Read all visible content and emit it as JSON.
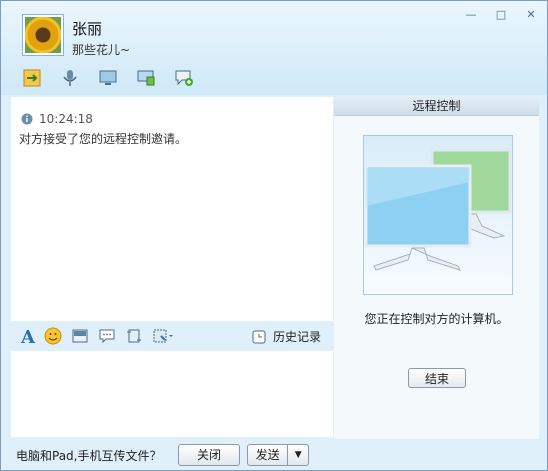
{
  "contact": {
    "name": "张丽",
    "signature": "那些花儿~"
  },
  "window_controls": {
    "minimize": "—",
    "maximize": "□",
    "close": "✕"
  },
  "toolbar": {
    "items": [
      "send-file-icon",
      "voice-icon",
      "remote-desktop-icon",
      "screen-share-icon",
      "chat-add-icon"
    ]
  },
  "chat": {
    "timestamp": "10:24:18",
    "message": "对方接受了您的远程控制邀请。"
  },
  "input_toolbar": {
    "tools": [
      "font-icon",
      "emoji-icon",
      "image-icon",
      "message-icon",
      "screenshot-icon",
      "more-icon"
    ],
    "history_label": "历史记录"
  },
  "remote_panel": {
    "title": "远程控制",
    "status": "您正在控制对方的计算机。",
    "end_button": "结束"
  },
  "bottom_bar": {
    "promo": "电脑和Pad,手机互传文件？",
    "close_button": "关闭",
    "send_button": "发送"
  },
  "colors": {
    "accent": "#dff0fa",
    "border": "#7f9db9",
    "green_screen": "#9fd89a",
    "blue_screen": "#8ed0f2"
  }
}
